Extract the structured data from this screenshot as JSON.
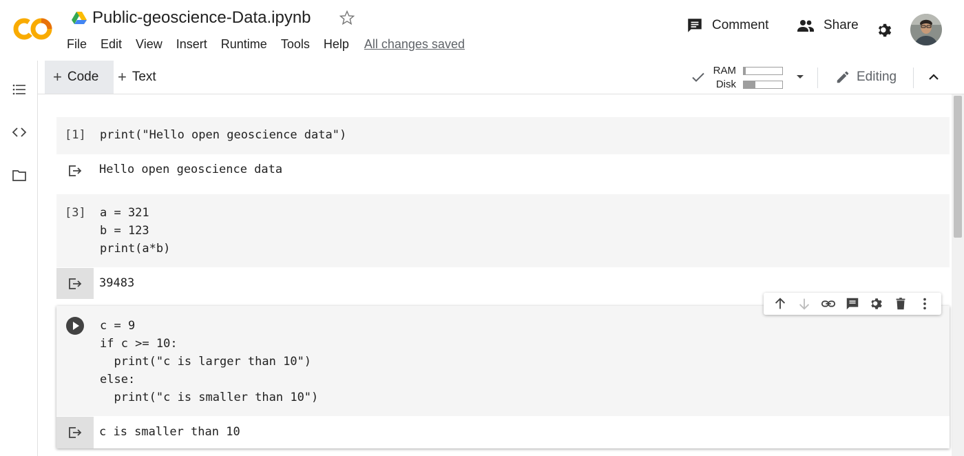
{
  "app": {
    "logo_text": "CO",
    "notebook_title": "Public-geoscience-Data.ipynb",
    "menu": [
      "File",
      "Edit",
      "View",
      "Insert",
      "Runtime",
      "Tools",
      "Help"
    ],
    "save_status": "All changes saved",
    "comment_label": "Comment",
    "share_label": "Share"
  },
  "toolbar": {
    "code_label": "Code",
    "text_label": "Text",
    "ram_label": "RAM",
    "disk_label": "Disk",
    "ram_usage": 0.05,
    "disk_usage": 0.3,
    "editing_label": "Editing"
  },
  "cells": [
    {
      "prompt": "[1]",
      "code": [
        "print(\"Hello open geoscience data\")"
      ],
      "output": "Hello open geoscience data"
    },
    {
      "prompt": "[3]",
      "code": [
        "a = 321",
        "b = 123",
        "print(a*b)"
      ],
      "output": "39483"
    },
    {
      "prompt": "",
      "code": [
        "c = 9",
        "if c >= 10:",
        "  print(\"c is larger than 10\")",
        "else:",
        "  print(\"c is smaller than 10\")"
      ],
      "output": "c is smaller than 10"
    }
  ],
  "cell_toolbar_icons": [
    "arrow-up-icon",
    "arrow-down-icon",
    "link-icon",
    "comment-icon",
    "gear-icon",
    "trash-icon",
    "more-vert-icon"
  ],
  "colors": {
    "logo_orange": "#F9AB00",
    "logo_dark": "#E8710A",
    "cell_bg": "#f5f5f5",
    "accent_text": "#5f6368"
  }
}
